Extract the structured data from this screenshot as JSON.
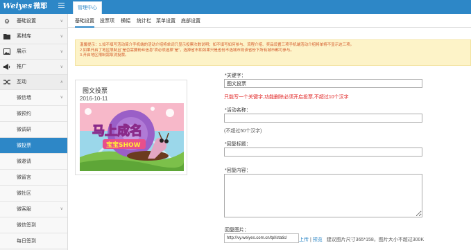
{
  "brand": {
    "logo_text": "Weiyes",
    "logo_cn": "微耶"
  },
  "header": {
    "manage_tab": "管理中心"
  },
  "sidebar": {
    "items": [
      {
        "label": "基础设置",
        "icon": "gear-icon"
      },
      {
        "label": "素材库",
        "icon": "folder-icon"
      },
      {
        "label": "展示",
        "icon": "image-icon"
      },
      {
        "label": "推广",
        "icon": "megaphone-icon"
      },
      {
        "label": "互动",
        "icon": "shuffle-icon"
      }
    ],
    "sub_items": [
      {
        "label": "微信墙"
      },
      {
        "label": "微预约"
      },
      {
        "label": "微调研"
      },
      {
        "label": "微投票"
      },
      {
        "label": "微邀请"
      },
      {
        "label": "微留言"
      },
      {
        "label": "微社区"
      },
      {
        "label": "微客服"
      },
      {
        "label": "微信签到"
      },
      {
        "label": "每日签到"
      }
    ]
  },
  "tabs": [
    "基础设置",
    "投票项",
    "横幅",
    "统计栏",
    "菜单设置",
    "底部设置"
  ],
  "notice": {
    "lines": [
      "温馨提示：1.如不填写活动简介手机端的活动介绍将单词只显示投票次数说明；如不填写如何参与、流程介绍、奖品设置三项手机端活动介绍将单将不显示这三项。",
      "2.如果开启了地区限制且“是否需要粉丝信息”项必须选择“是”，选择省市和如果只是省份不选城市则该省份下所有城市都可参与。",
      "3.开启地区限制需取消投票。"
    ]
  },
  "card": {
    "title": "图文投票",
    "date": "2016-10-11",
    "poster_line1": "马上成名",
    "poster_line2": "宝宝SHOW"
  },
  "form": {
    "keyword_label": "*关键字：",
    "keyword_value": "图文投票",
    "keyword_warning": "只能写一个关键字,功能删除必须开启投票,不超过10个汉字",
    "name_label": "*活动名称：",
    "name_value": "",
    "name_note": "(不超过50个汉字)",
    "reply_title_label": "*回复标题：",
    "reply_title_value": "",
    "reply_content_label": "*回复内容：",
    "reply_image_label": "回复图片：",
    "reply_image_url": "http://vy.weiyes.com.cn/tpl/static/",
    "upload_label": "上传",
    "separator": "|",
    "preview_label": "预览",
    "image_hint": "建议图片尺寸365*158，图片大小不超过300K"
  },
  "colors": {
    "primary": "#2d87c7",
    "warning_bg": "#fdf3c8",
    "warning_text": "#d35a2a",
    "error": "#e02020"
  }
}
